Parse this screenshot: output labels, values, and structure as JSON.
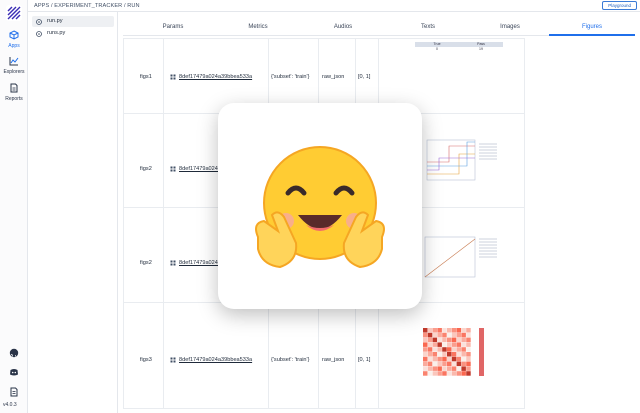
{
  "breadcrumb": "APPS / EXPERIMENT_TRACKER / RUN",
  "playground_label": "Playground",
  "rail": {
    "items": [
      {
        "label": "Apps",
        "icon": "cube-icon",
        "active": true
      },
      {
        "label": "Explorers",
        "icon": "chart-icon",
        "active": false
      },
      {
        "label": "Reports",
        "icon": "document-icon",
        "active": false
      }
    ],
    "bottom_icons": [
      "github-icon",
      "discord-icon",
      "docs-icon"
    ],
    "version": "v4.0.3"
  },
  "files": [
    {
      "name": "run.py",
      "selected": true
    },
    {
      "name": "runs.py",
      "selected": false
    }
  ],
  "tabs": [
    {
      "label": "Params",
      "active": false
    },
    {
      "label": "Metrics",
      "active": false
    },
    {
      "label": "Audios",
      "active": false
    },
    {
      "label": "Texts",
      "active": false
    },
    {
      "label": "Images",
      "active": false
    },
    {
      "label": "Figures",
      "active": true
    }
  ],
  "rows": [
    {
      "name": "figs1",
      "hash": "8def17479a024a39bbea533a",
      "context": "{'subset': 'train'}",
      "format": "raw_json",
      "range": "[0, 1]",
      "figure": "table"
    },
    {
      "name": "figs2",
      "hash": "8def17479a024a39bbea533a",
      "context": "",
      "format": "",
      "range": "",
      "figure": "step"
    },
    {
      "name": "figs2",
      "hash": "8def17479a024a39bbea533a",
      "context": "",
      "format": "",
      "range": "",
      "figure": "line"
    },
    {
      "name": "figs3",
      "hash": "8def17479a024a39bbea533a",
      "context": "{'subset': 'train'}",
      "format": "raw_json",
      "range": "[0, 1]",
      "figure": "heatmap"
    }
  ],
  "figure_table": {
    "headers": [
      "True",
      "Pass"
    ],
    "values": [
      "0",
      "19"
    ]
  },
  "overlay": {
    "icon": "hugging-face-emoji-icon"
  },
  "colors": {
    "accent": "#1f6feb",
    "overlay_face": "#FFCC33"
  }
}
